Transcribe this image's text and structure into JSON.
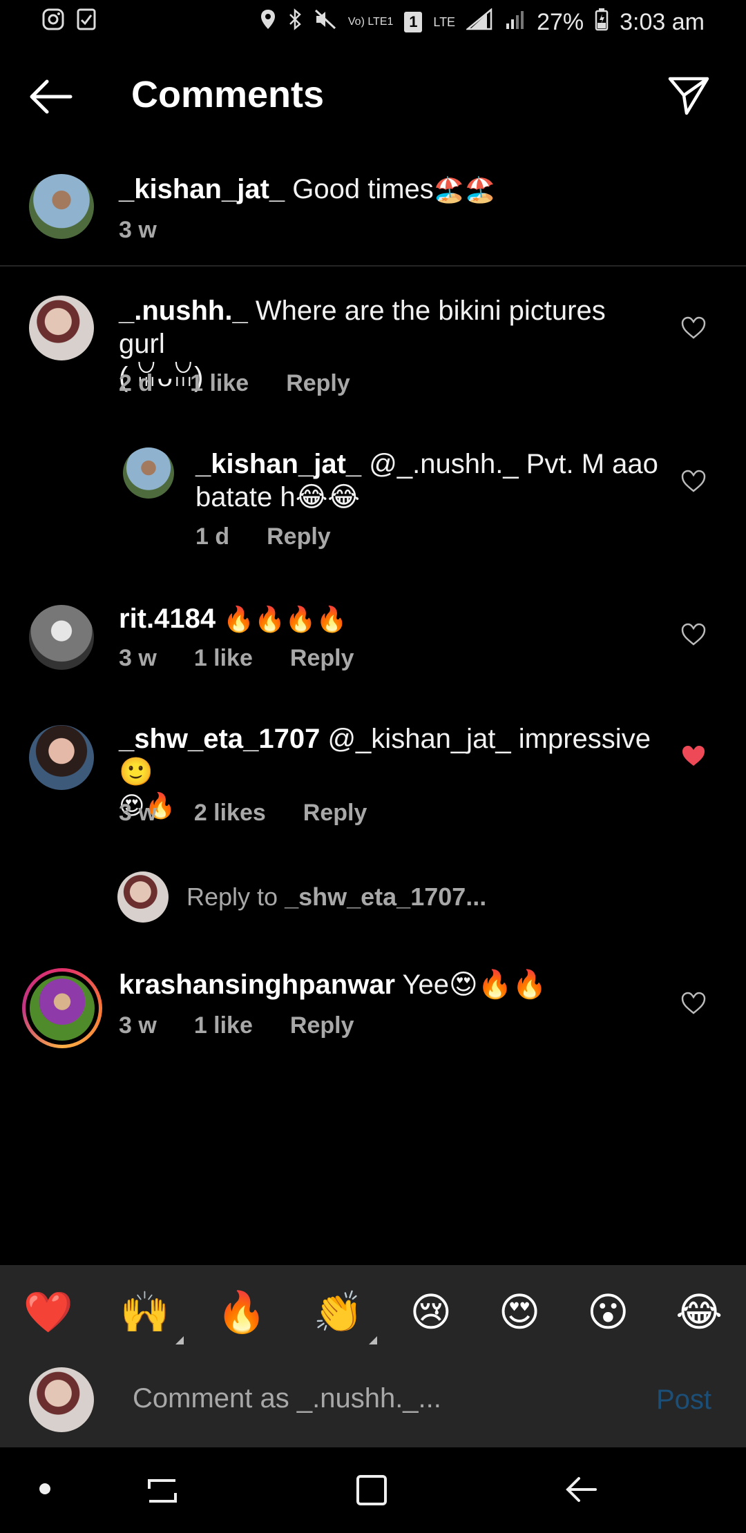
{
  "status_bar": {
    "battery": "27%",
    "time": "3:03 am",
    "lte_label": "LTE",
    "volte_label": "Vo) LTE1"
  },
  "header": {
    "title": "Comments"
  },
  "caption": {
    "username": "_kishan_jat_",
    "text": "Good times",
    "emoji": "🏖️🏖️",
    "time": "3 w"
  },
  "comments": [
    {
      "username": "_.nushh._",
      "text": "Where are the bikini pictures gurl",
      "text_line2": "( ꈍᴗꈍ)",
      "time": "2 d",
      "likes": "1 like",
      "reply": "Reply",
      "liked": false
    },
    {
      "username": "_kishan_jat_",
      "text": "@_.nushh._ Pvt. M aao",
      "text_line2": "batate h😂😂",
      "time": "1 d",
      "likes": "",
      "reply": "Reply",
      "liked": false
    },
    {
      "username": "rit.4184",
      "text": "🔥🔥🔥🔥",
      "time": "3 w",
      "likes": "1 like",
      "reply": "Reply",
      "liked": false
    },
    {
      "username": "_shw_eta_1707",
      "text": "@_kishan_jat_ impressive 🙂",
      "text_line2": "😍🔥",
      "time": "3 w",
      "likes": "2 likes",
      "reply": "Reply",
      "liked": true
    },
    {
      "username": "krashansinghpanwar",
      "text": "Yee😍🔥🔥",
      "time": "3 w",
      "likes": "1 like",
      "reply": "Reply",
      "liked": false
    }
  ],
  "reply_to": {
    "prefix": "Reply to",
    "username": "_shw_eta_1707..."
  },
  "quick_emojis": [
    "❤️",
    "🙌",
    "🔥",
    "👏",
    "😢",
    "😍",
    "😮",
    "😂"
  ],
  "composer": {
    "placeholder": "Comment as _.nushh._...",
    "post_label": "Post"
  },
  "colors": {
    "accent_heart": "#ed4956",
    "post_disabled": "#1c4f78",
    "bar_bg": "#262626"
  }
}
